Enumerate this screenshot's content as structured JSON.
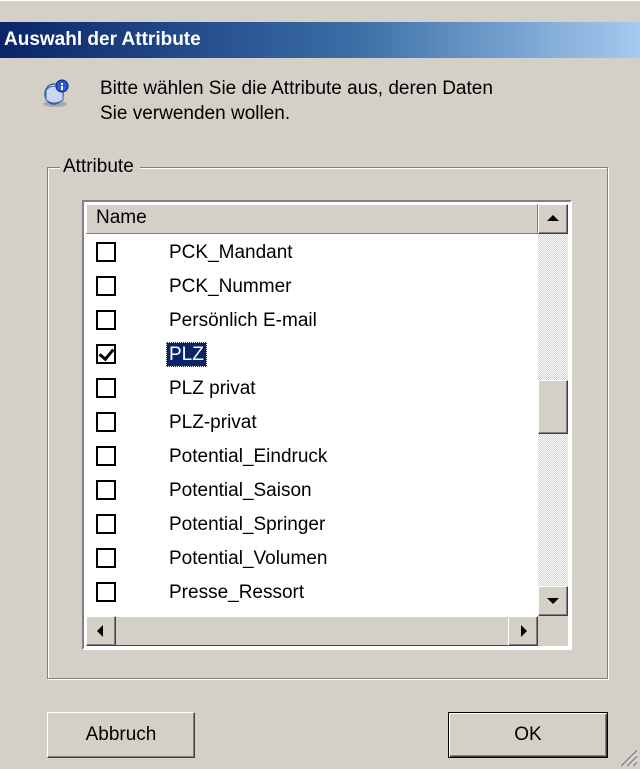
{
  "dialog": {
    "title": "Auswahl der Attribute",
    "info_line1": "Bitte wählen Sie die Attribute aus, deren Daten",
    "info_line2": "Sie verwenden wollen.",
    "info_icon": "info-icon"
  },
  "group": {
    "legend": "Attribute",
    "column_header": "Name",
    "items": [
      {
        "label": "PCK_Mandant",
        "checked": false,
        "selected": false
      },
      {
        "label": "PCK_Nummer",
        "checked": false,
        "selected": false
      },
      {
        "label": "Persönlich E-mail",
        "checked": false,
        "selected": false
      },
      {
        "label": "PLZ",
        "checked": true,
        "selected": true
      },
      {
        "label": "PLZ  privat",
        "checked": false,
        "selected": false
      },
      {
        "label": "PLZ-privat",
        "checked": false,
        "selected": false
      },
      {
        "label": "Potential_Eindruck",
        "checked": false,
        "selected": false
      },
      {
        "label": "Potential_Saison",
        "checked": false,
        "selected": false
      },
      {
        "label": "Potential_Springer",
        "checked": false,
        "selected": false
      },
      {
        "label": "Potential_Volumen",
        "checked": false,
        "selected": false
      },
      {
        "label": "Presse_Ressort",
        "checked": false,
        "selected": false
      }
    ]
  },
  "buttons": {
    "cancel": "Abbruch",
    "ok": "OK"
  },
  "colors": {
    "title_gradient_start": "#0a246a",
    "title_gradient_end": "#a6caf0",
    "selection": "#0a246a",
    "face": "#d4d0c8"
  }
}
